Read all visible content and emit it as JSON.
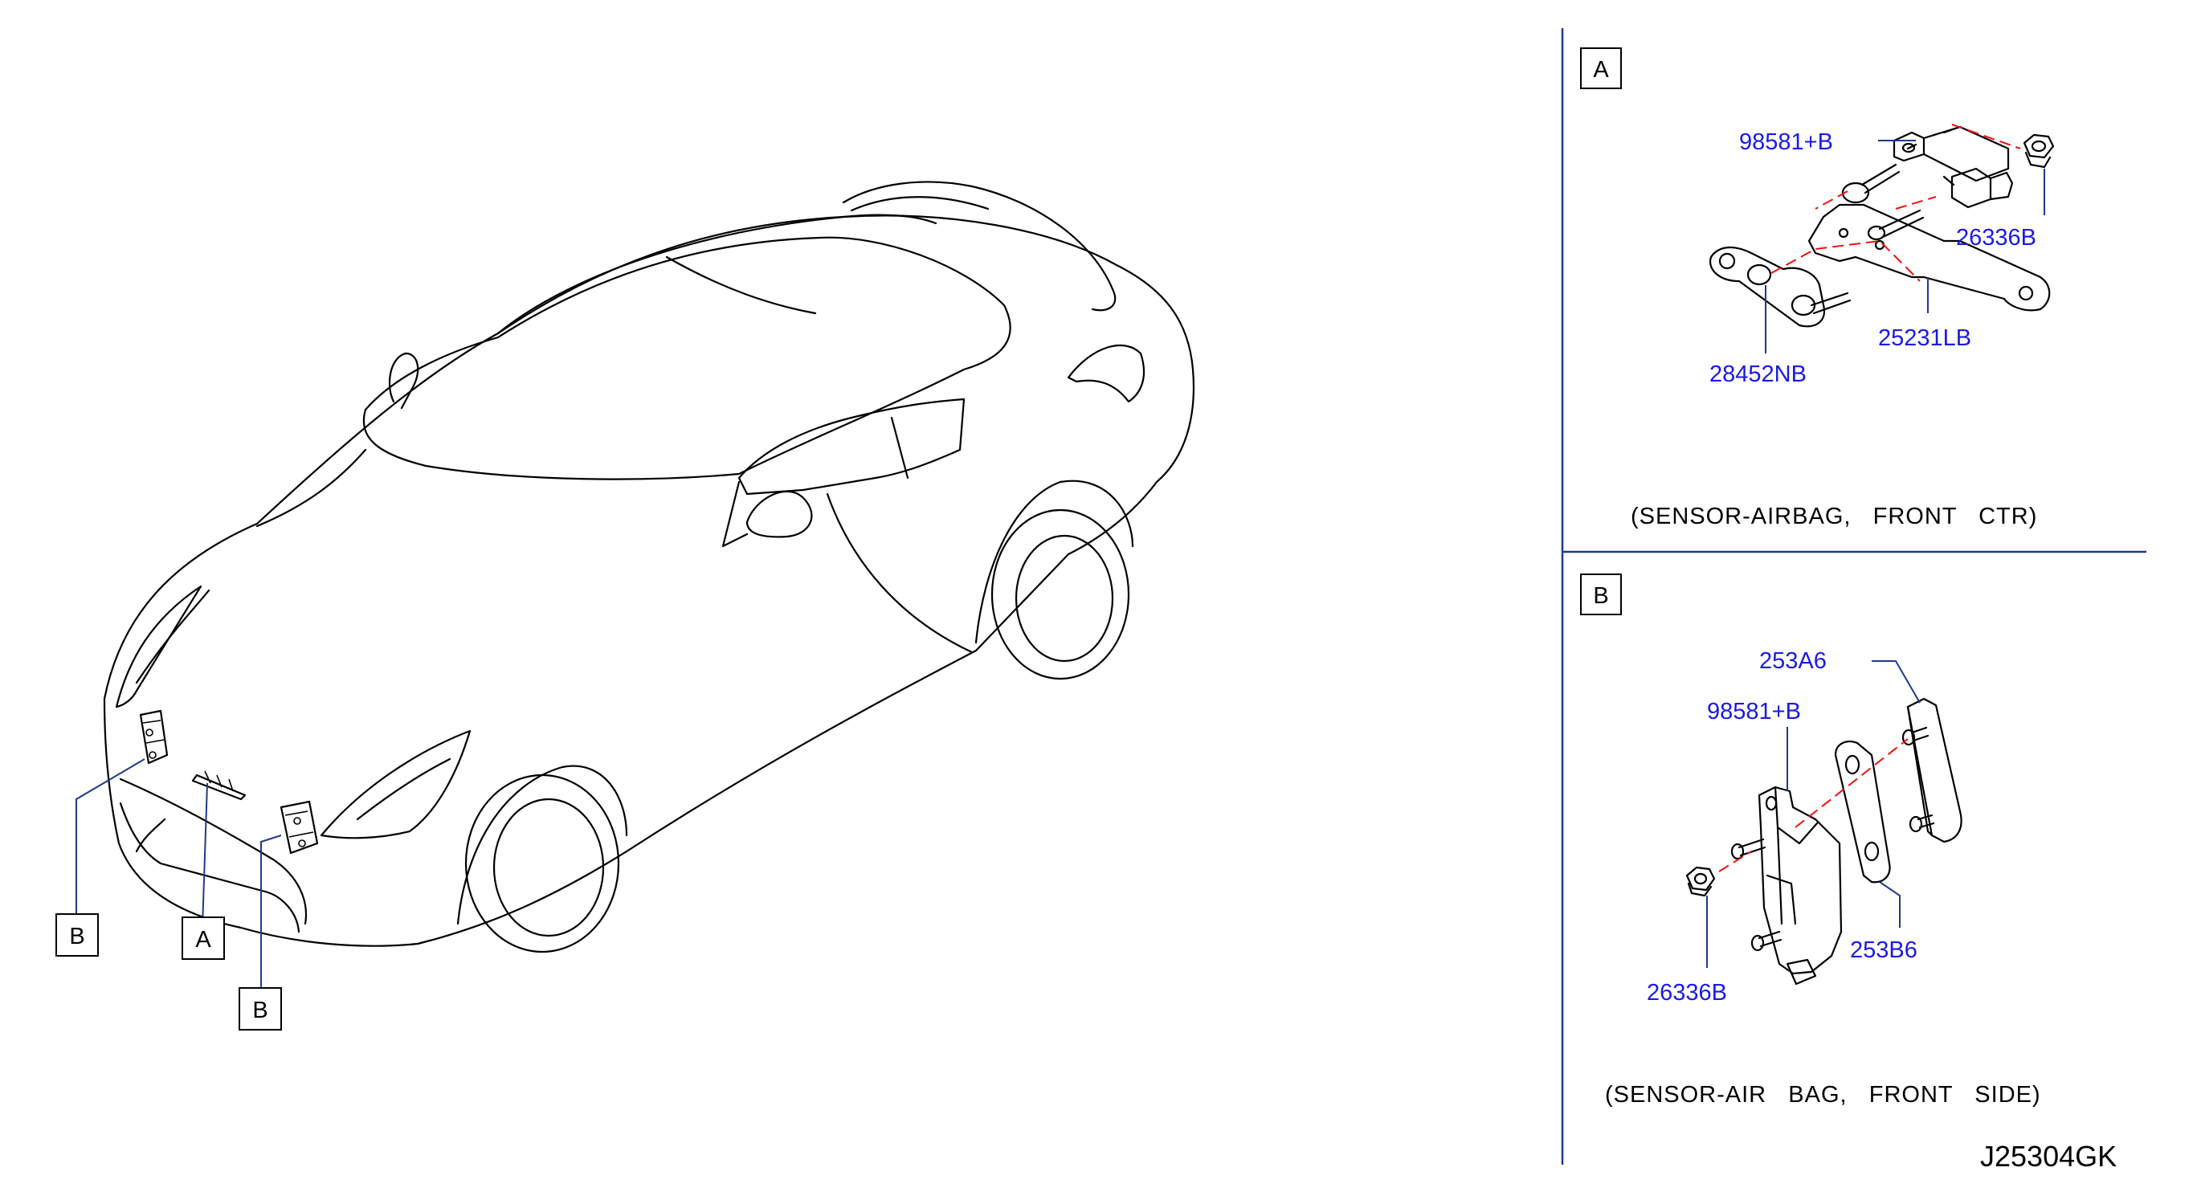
{
  "diagram": {
    "reference_code": "J25304GK",
    "callouts": {
      "front_left": "B",
      "center": "A",
      "front_right": "B"
    },
    "panel_a": {
      "label": "A",
      "caption": "(SENSOR-AIRBAG,   FRONT   CTR)",
      "parts": {
        "sensor": "98581+B",
        "nut": "26336B",
        "bracket": "25231LB",
        "plate": "28452NB"
      }
    },
    "panel_b": {
      "label": "B",
      "caption": "(SENSOR-AIR   BAG,   FRONT   SIDE)",
      "parts": {
        "bracket": "253A6",
        "sensor": "98581+B",
        "spacer": "253B6",
        "nut": "26336B"
      }
    }
  }
}
